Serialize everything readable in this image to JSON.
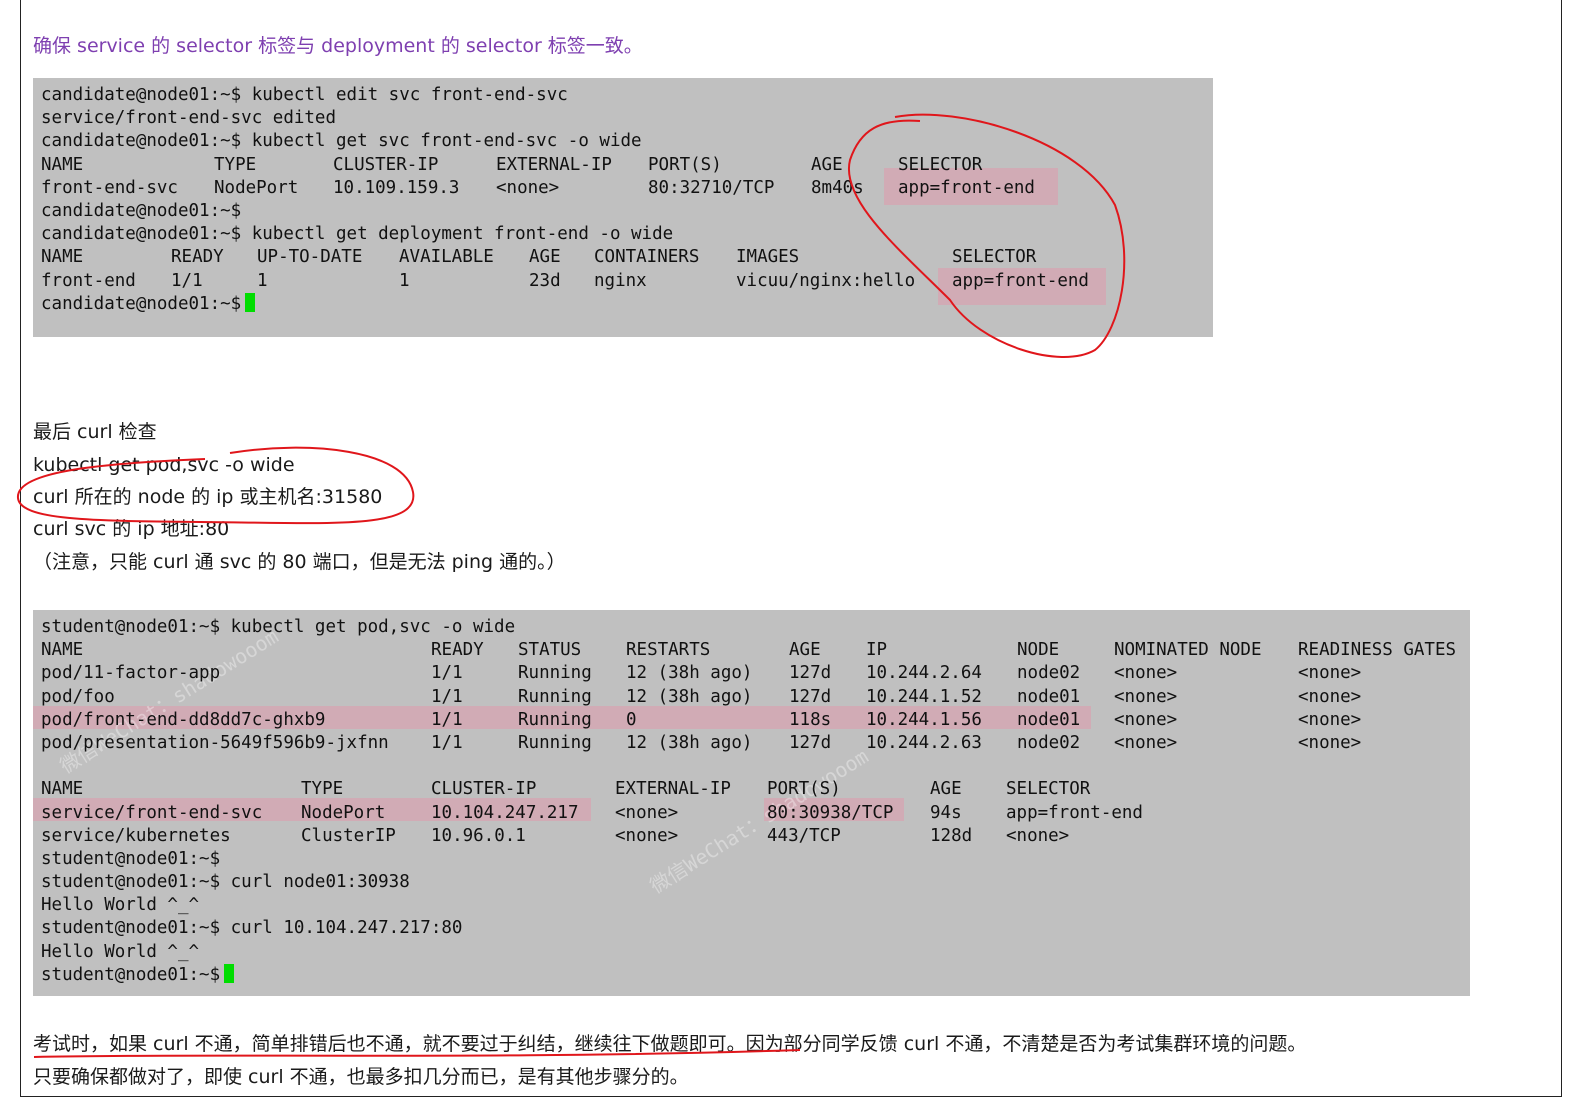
{
  "heading1": "确保 service 的 selector 标签与 deployment 的 selector 标签一致。",
  "terminal1": {
    "lines": [
      {
        "cols": [
          [
            "candidate@node01:~$ kubectl edit svc front-end-svc",
            0
          ]
        ]
      },
      {
        "cols": [
          [
            "service/front-end-svc edited",
            0
          ]
        ]
      },
      {
        "cols": [
          [
            "candidate@node01:~$ kubectl get svc front-end-svc -o wide",
            0
          ]
        ]
      },
      {
        "cols": [
          [
            "NAME",
            0
          ],
          [
            "TYPE",
            173
          ],
          [
            "CLUSTER-IP",
            292
          ],
          [
            "EXTERNAL-IP",
            455
          ],
          [
            "PORT(S)",
            607
          ],
          [
            "AGE",
            770
          ],
          [
            "SELECTOR",
            857
          ]
        ]
      },
      {
        "cols": [
          [
            "front-end-svc",
            0
          ],
          [
            "NodePort",
            173
          ],
          [
            "10.109.159.3",
            292
          ],
          [
            "<none>",
            455
          ],
          [
            "80:32710/TCP",
            607
          ],
          [
            "8m40s",
            770
          ],
          [
            "app=front-end",
            857
          ]
        ]
      },
      {
        "cols": [
          [
            "candidate@node01:~$",
            0
          ]
        ]
      },
      {
        "cols": [
          [
            "candidate@node01:~$ kubectl get deployment front-end -o wide",
            0
          ]
        ]
      },
      {
        "cols": [
          [
            "NAME",
            0
          ],
          [
            "READY",
            130
          ],
          [
            "UP-TO-DATE",
            216
          ],
          [
            "AVAILABLE",
            358
          ],
          [
            "AGE",
            488
          ],
          [
            "CONTAINERS",
            553
          ],
          [
            "IMAGES",
            695
          ],
          [
            "SELECTOR",
            911
          ]
        ]
      },
      {
        "cols": [
          [
            "front-end",
            0
          ],
          [
            "1/1",
            130
          ],
          [
            "1",
            216
          ],
          [
            "1",
            358
          ],
          [
            "23d",
            488
          ],
          [
            "nginx",
            553
          ],
          [
            "vicuu/nginx:hello",
            695
          ],
          [
            "app=front-end",
            911
          ]
        ]
      },
      {
        "cols": [
          [
            "candidate@node01:~$",
            0
          ]
        ],
        "cursor": true
      }
    ]
  },
  "para": {
    "line1": "最后 curl 检查",
    "line2": "kubectl get pod,svc -o wide",
    "line3": "curl  所在的 node 的 ip 或主机名:31580",
    "line4": "curl svc 的 ip 地址:80",
    "line5": "（注意，只能 curl 通 svc 的 80 端口，但是无法 ping 通的。）"
  },
  "terminal2": {
    "lines": [
      {
        "cols": [
          [
            "student@node01:~$ kubectl get pod,svc -o wide",
            0
          ]
        ]
      },
      {
        "cols": [
          [
            "NAME",
            0
          ],
          [
            "READY",
            390
          ],
          [
            "STATUS",
            477
          ],
          [
            "RESTARTS",
            585
          ],
          [
            "AGE",
            748
          ],
          [
            "IP",
            825
          ],
          [
            "NODE",
            976
          ],
          [
            "NOMINATED NODE",
            1073
          ],
          [
            "READINESS GATES",
            1257
          ]
        ]
      },
      {
        "cols": [
          [
            "pod/11-factor-app",
            0
          ],
          [
            "1/1",
            390
          ],
          [
            "Running",
            477
          ],
          [
            "12 (38h ago)",
            585
          ],
          [
            "127d",
            748
          ],
          [
            "10.244.2.64",
            825
          ],
          [
            "node02",
            976
          ],
          [
            "<none>",
            1073
          ],
          [
            "<none>",
            1257
          ]
        ]
      },
      {
        "cols": [
          [
            "pod/foo",
            0
          ],
          [
            "1/1",
            390
          ],
          [
            "Running",
            477
          ],
          [
            "12 (38h ago)",
            585
          ],
          [
            "127d",
            748
          ],
          [
            "10.244.1.52",
            825
          ],
          [
            "node01",
            976
          ],
          [
            "<none>",
            1073
          ],
          [
            "<none>",
            1257
          ]
        ]
      },
      {
        "cols": [
          [
            "pod/front-end-dd8dd7c-ghxb9",
            0
          ],
          [
            "1/1",
            390
          ],
          [
            "Running",
            477
          ],
          [
            "0",
            585
          ],
          [
            "118s",
            748
          ],
          [
            "10.244.1.56",
            825
          ],
          [
            "node01",
            976
          ],
          [
            "<none>",
            1073
          ],
          [
            "<none>",
            1257
          ]
        ]
      },
      {
        "cols": [
          [
            "pod/presentation-5649f596b9-jxfnn",
            0
          ],
          [
            "1/1",
            390
          ],
          [
            "Running",
            477
          ],
          [
            "12 (38h ago)",
            585
          ],
          [
            "127d",
            748
          ],
          [
            "10.244.2.63",
            825
          ],
          [
            "node02",
            976
          ],
          [
            "<none>",
            1073
          ],
          [
            "<none>",
            1257
          ]
        ]
      },
      {
        "cols": [
          [
            "",
            0
          ]
        ]
      },
      {
        "cols": [
          [
            "NAME",
            0
          ],
          [
            "TYPE",
            260
          ],
          [
            "CLUSTER-IP",
            390
          ],
          [
            "EXTERNAL-IP",
            574
          ],
          [
            "PORT(S)",
            726
          ],
          [
            "AGE",
            889
          ],
          [
            "SELECTOR",
            965
          ]
        ]
      },
      {
        "cols": [
          [
            "service/front-end-svc",
            0
          ],
          [
            "NodePort",
            260
          ],
          [
            "10.104.247.217",
            390
          ],
          [
            "<none>",
            574
          ],
          [
            "80:30938/TCP",
            726
          ],
          [
            "94s",
            889
          ],
          [
            "app=front-end",
            965
          ]
        ]
      },
      {
        "cols": [
          [
            "service/kubernetes",
            0
          ],
          [
            "ClusterIP",
            260
          ],
          [
            "10.96.0.1",
            390
          ],
          [
            "<none>",
            574
          ],
          [
            "443/TCP",
            726
          ],
          [
            "128d",
            889
          ],
          [
            "<none>",
            965
          ]
        ]
      },
      {
        "cols": [
          [
            "student@node01:~$",
            0
          ]
        ]
      },
      {
        "cols": [
          [
            "student@node01:~$ curl node01:30938",
            0
          ]
        ]
      },
      {
        "cols": [
          [
            "Hello World ^_^",
            0
          ]
        ]
      },
      {
        "cols": [
          [
            "student@node01:~$ curl 10.104.247.217:80",
            0
          ]
        ]
      },
      {
        "cols": [
          [
            "Hello World ^_^",
            0
          ]
        ]
      },
      {
        "cols": [
          [
            "student@node01:~$",
            0
          ]
        ],
        "cursor": true
      }
    ]
  },
  "footer": {
    "line1": "考试时，如果 curl 不通，简单排错后也不通，就不要过于纠结，继续往下做题即可。因为部分同学反馈 curl 不通，不清楚是否为考试集群环境的问题。",
    "line2": "只要确保都做对了，即使 curl 不通，也最多扣几分而已，是有其他步骤分的。"
  },
  "watermarks": [
    "微信WeChat：shadowooom",
    "微信WeChat：shadowooom"
  ],
  "colors": {
    "heading": "#7e3fb0",
    "terminal_bg": "#c0c0c0",
    "highlight": "#d4a7b3",
    "annotation": "#e0161b",
    "cursor": "#00dd00"
  }
}
